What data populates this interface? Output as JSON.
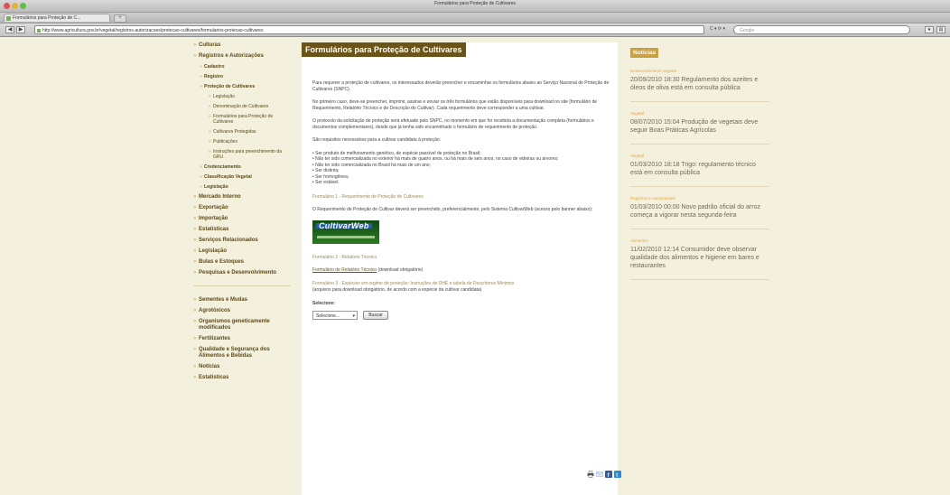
{
  "browser": {
    "window_title": "Formulários para Proteção de Cultivares",
    "tab_title": "Formulários para Proteção de C...",
    "new_tab_label": "+",
    "url": "http://www.agricultura.gov.br/vegetal/registros-autorizacoes/protecao-cultivares/formularios-protecao-cultivares",
    "search_placeholder": "Google",
    "back_label": "◀",
    "forward_label": "▶",
    "url_controls": "C ▾  ⟳ ▾",
    "bookmark_label": "★",
    "menu_label": "▤"
  },
  "left_nav": {
    "top_items": [
      "Culturas",
      "Registros e Autorizações"
    ],
    "sub_items": [
      "Cadastro",
      "Registro",
      "Proteção de Cultivares"
    ],
    "sub3_items": [
      "Legislação",
      "Denominação de Cultivares",
      "Formulários para Proteção de Cultivares",
      "Cultivares Protegidas",
      "Publicações",
      "Instruções para preenchimento da GRU"
    ],
    "sub_items_b": [
      "Credenciamento",
      "Classificação Vegetal",
      "Legislação"
    ],
    "main_items": [
      "Mercado Interno",
      "Exportação",
      "Importação",
      "Estatísticas",
      "Serviços Relacionados",
      "Legislação",
      "Bulas e Estoques",
      "Pesquisas e Desenvolvimento"
    ],
    "other_items": [
      "Sementes e Mudas",
      "Agrotóxicos",
      "Organismos geneticamente modificados",
      "Fertilizantes",
      "Qualidade e Segurança dos Alimentos e Bebidas",
      "Notícias",
      "Estatísticas"
    ],
    "bullet": "»"
  },
  "content": {
    "title": "Formulários para Proteção de Cultivares",
    "paragraphs": [
      "Para requerer a proteção de cultivares, os interessados deverão preencher e encaminhar os formulários abaixo ao Serviço Nacional de Proteção de Cultivares (SNPC).",
      "No primeiro caso, deve-se preencher, imprimir, assinar e enviar os três formulários que estão disponíveis para download no site (formulário de Requerimento, Relatório Técnico e de Descrição do Cultivar). Cada requerimento deve corresponder a uma cultivar.",
      "O protocolo da solicitação de proteção será efetuado pelo SNPC, no momento em que for recebida a documentação completa (formulários e documentos complementares), desde que já tenha sido encaminhado o formulário de requerimento de proteção.",
      "São requisitos necessários para a cultivar candidata à proteção:"
    ],
    "requirements": [
      "• Ser produto de melhoramento genético, de espécie passível de proteção no Brasil;",
      "• Não ter sido comercializada no exterior há mais de quatro anos, ou há mais de seis anos, no caso de videiras ou árvores;",
      "• Não ter sido comercializada no Brasil há mais de um ano;",
      "• Ser distinta;",
      "• Ser homogênea;",
      "• Ser estável."
    ],
    "form1_heading": "Formulário 1 - Requerimento de Proteção de Cultivares",
    "form1_text": "O Requerimento de Proteção de Cultivar deverá ser preenchido, preferencialmente, pelo Sistema CultivarWeb (acesso pelo banner abaixo):",
    "logo_text": "CultivarWeb",
    "form2_heading": "Formulário 2 - Relatório Técnico",
    "form2_link": "Formulário de Relatório Técnico",
    "form2_suffix": " (download obrigatório)",
    "form3_heading": "Formulário 3 - Espécies em regime de proteção: Instruções de DHE e tabela de Descritores Mínimos",
    "form3_text": "(arquivos para download obrigatório, de acordo com a espécie da cultivar candidata)",
    "select_label": "Selecione:",
    "select_value": "Selecione...",
    "select_arrow": "▾",
    "button_label": "Buscar"
  },
  "share_icons": [
    {
      "name": "print-icon",
      "color": "#555555"
    },
    {
      "name": "email-icon",
      "color": "#9ab8d8"
    },
    {
      "name": "facebook-icon",
      "color": "#3b5998"
    },
    {
      "name": "twitter-icon",
      "color": "#2f8ad6"
    }
  ],
  "news": {
    "heading": "Notícias",
    "items": [
      {
        "category": "Desenvolvimento Vegetal",
        "text": "20/09/2010 18:30 Regulamento dos azeites e óleos de oliva está em consulta pública"
      },
      {
        "category": "Vegetal",
        "text": "08/07/2010 15:04 Produção de vegetais deve seguir Boas Práticas Agrícolas"
      },
      {
        "category": "Vegetal",
        "text": "01/03/2010 18:18 Trigo: regulamento técnico está em consulta pública"
      },
      {
        "category": "Registros e Autorizações",
        "text": "01/03/2010 00:00 Novo padrão oficial do arroz começa a vigorar nesta segunda-feira"
      },
      {
        "category": "Alimentos",
        "text": "11/02/2010 12:14 Consumidor deve observar qualidade dos alimentos e higiene em bares e restaurantes"
      }
    ]
  },
  "colors": {
    "page_bg": "#f3f0dd",
    "title_bg": "#6b5418",
    "news_heading_bg": "#caa045",
    "news_category": "#e5a84a",
    "nav_text": "#5b4a18"
  }
}
